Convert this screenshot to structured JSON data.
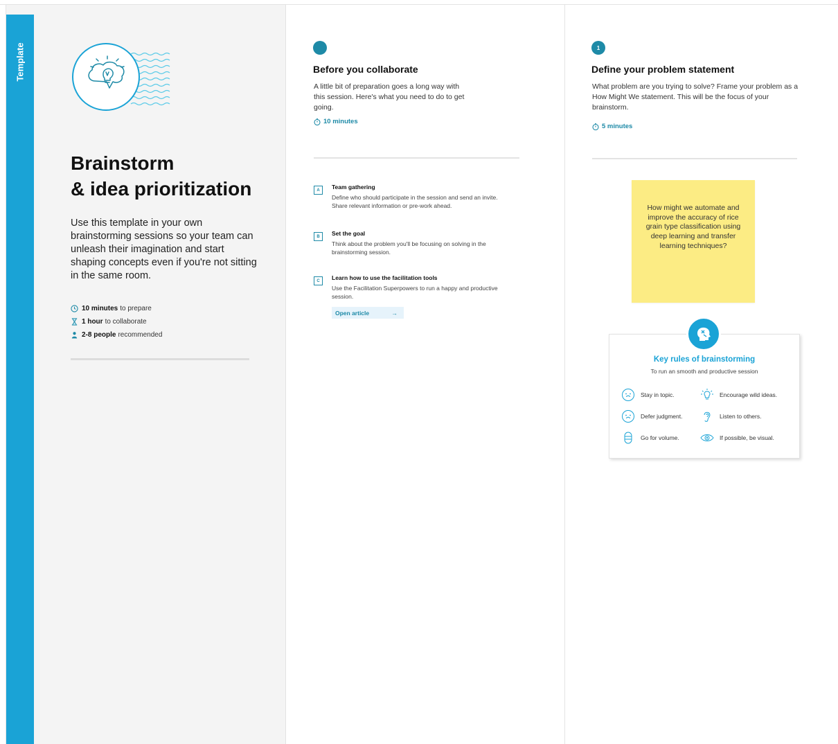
{
  "template_tab": {
    "label": "Template"
  },
  "intro": {
    "title_line1": "Brainstorm",
    "title_line2": "& idea prioritization",
    "description": "Use this template in your own brainstorming sessions so your team can unleash their imagination and start shaping concepts even if you're not sitting in the same room.",
    "meta": [
      {
        "bold": "10 minutes",
        "rest": "to prepare",
        "icon": "clock-icon"
      },
      {
        "bold": "1 hour",
        "rest": "to collaborate",
        "icon": "hourglass-icon"
      },
      {
        "bold": "2-8 people",
        "rest": "recommended",
        "icon": "person-icon"
      }
    ]
  },
  "before": {
    "title": "Before you collaborate",
    "description": "A little bit of preparation goes a long way with this session. Here's what you need to do to get going.",
    "time": "10 minutes",
    "steps": [
      {
        "badge": "A",
        "title": "Team gathering",
        "description": "Define who should participate in the session and send an invite. Share relevant information or pre-work ahead."
      },
      {
        "badge": "B",
        "title": "Set the goal",
        "description": "Think about the problem you'll be focusing on solving in the brainstorming session."
      },
      {
        "badge": "C",
        "title": "Learn how to use the facilitation tools",
        "description": "Use the Facilitation Superpowers to run a happy and productive session."
      }
    ],
    "open_article": "Open article",
    "open_article_arrow": "→"
  },
  "define": {
    "number": "1",
    "title": "Define your problem statement",
    "description": "What problem are you trying to solve? Frame your problem as a How Might We statement. This will be the focus of your brainstorm.",
    "time": "5 minutes",
    "sticky_note": "How might we automate and improve the accuracy of rice grain type classification using deep learning and transfer learning techniques?",
    "rules": {
      "title": "Key rules of brainstorming",
      "subtitle": "To run an smooth and productive session",
      "items": [
        "Stay in topic.",
        "Encourage wild ideas.",
        "Defer judgment.",
        "Listen to others.",
        "Go for volume.",
        "If possible, be visual."
      ]
    }
  },
  "colors": {
    "accent": "#1aa3d6",
    "teal": "#1e8aa7",
    "sticky": "#fcec84",
    "panel_bg": "#f4f4f4"
  }
}
